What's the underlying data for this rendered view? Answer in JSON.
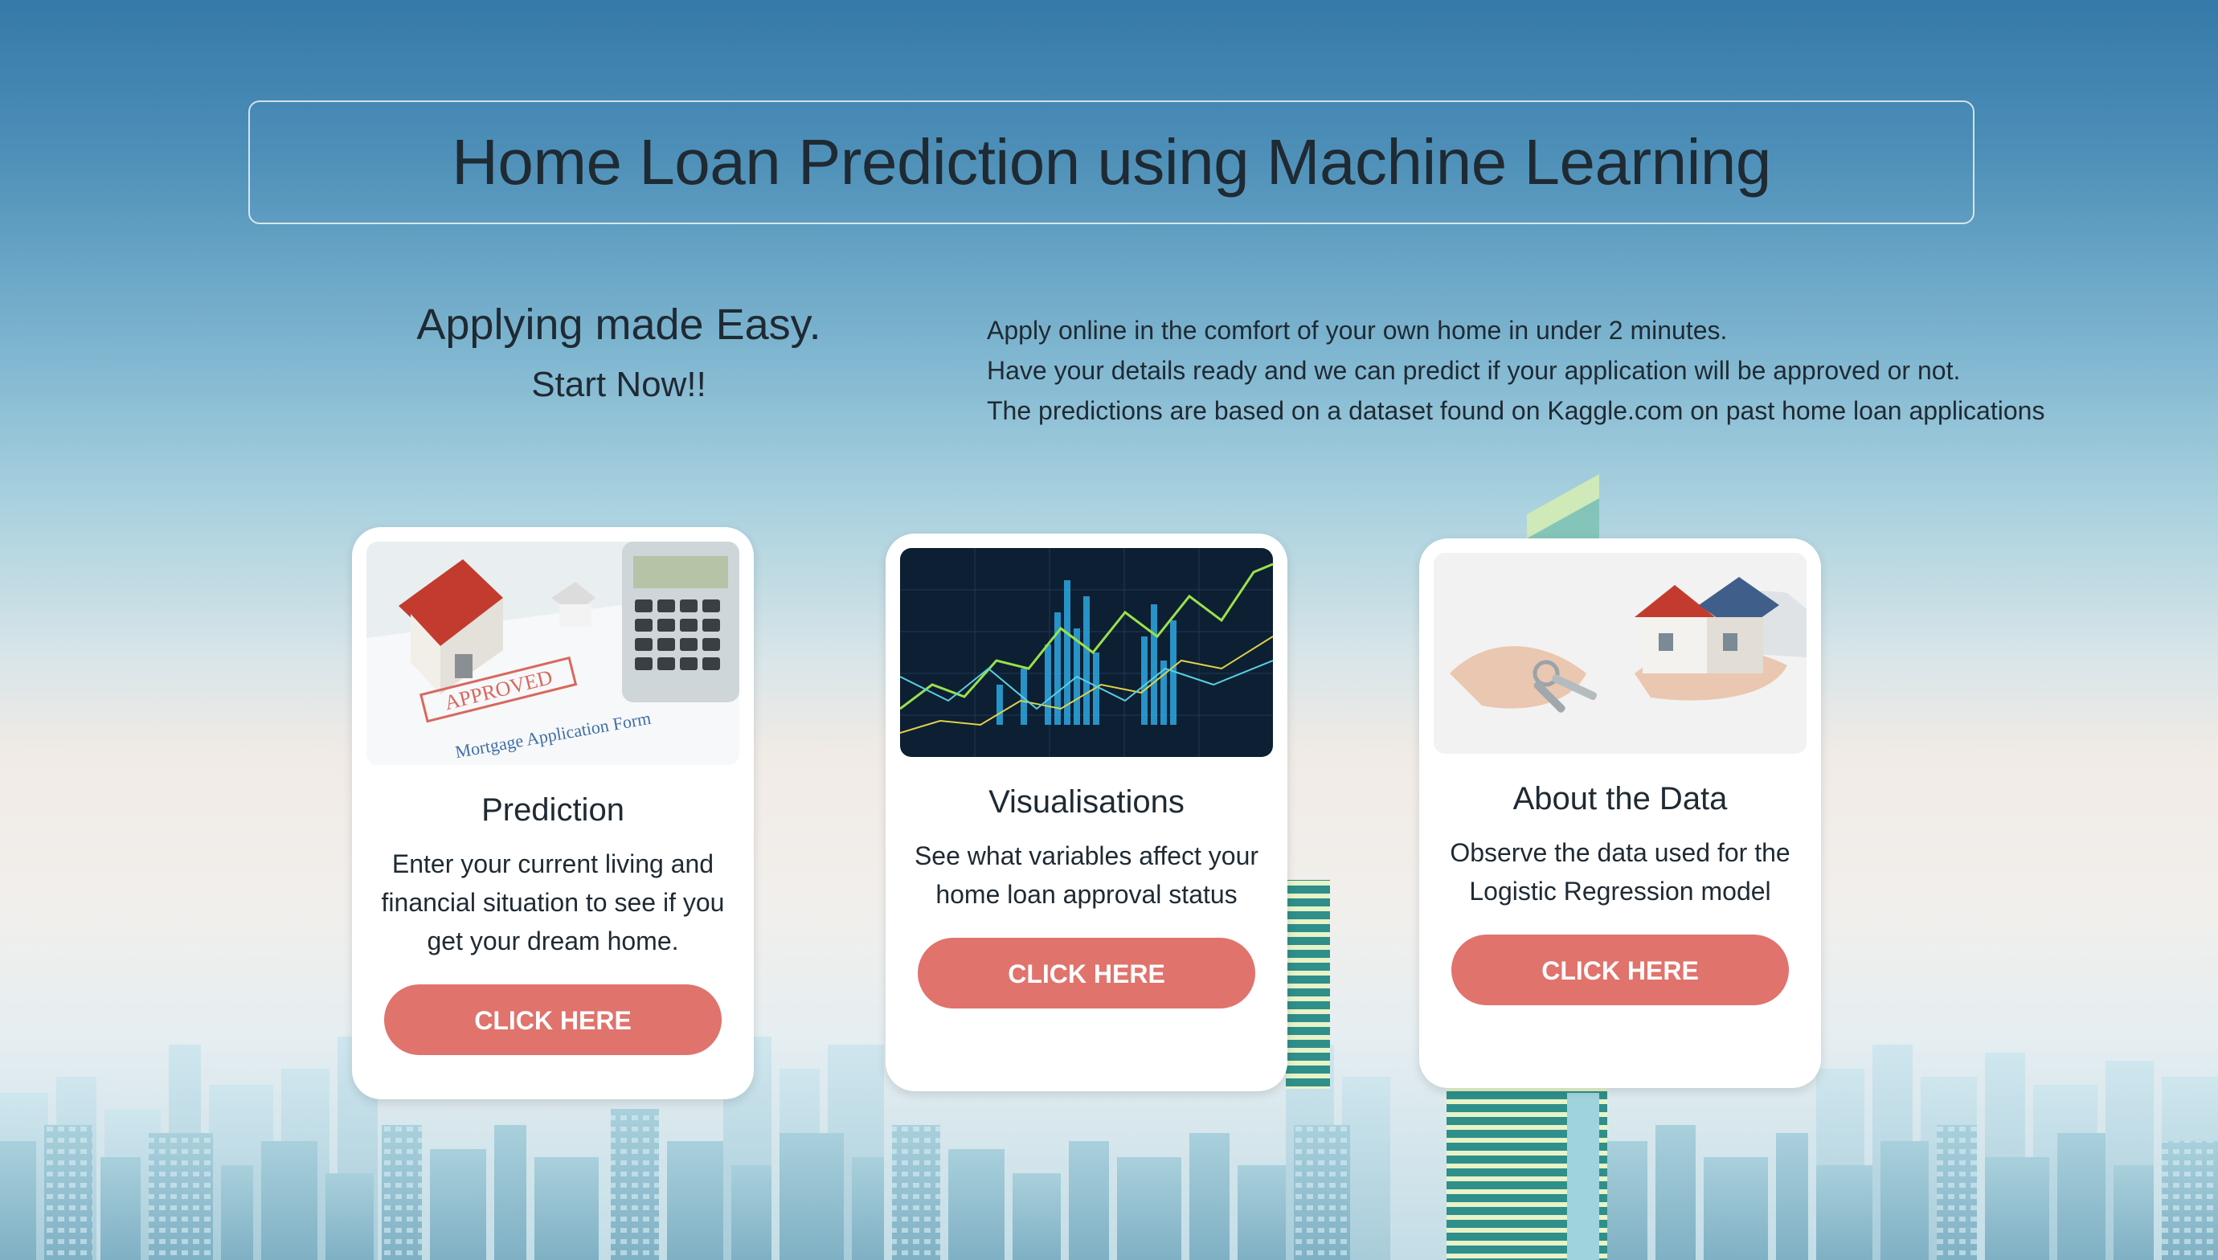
{
  "header": {
    "title": "Home Loan Prediction using Machine Learning"
  },
  "tagline": {
    "line1": "Applying made Easy.",
    "line2": "Start Now!!"
  },
  "intro": {
    "lines": [
      "Apply online in the comfort of your own home in under 2 minutes.",
      "Have your details ready and we can predict if your application will be approved or not.",
      "The predictions are based on a dataset found on Kaggle.com on past home loan applications"
    ]
  },
  "cards": [
    {
      "title": "Prediction",
      "description": "Enter your current living and financial situation to see if you get your dream home.",
      "button": "CLICK HERE",
      "image": {
        "stamp": "APPROVED",
        "form_text": "Mortgage Application Form"
      }
    },
    {
      "title": "Visualisations",
      "description": "See what variables affect your home loan approval status",
      "button": "CLICK HERE"
    },
    {
      "title": "About the Data",
      "description": "Observe the data used for the Logistic Regression model",
      "button": "CLICK HERE"
    }
  ],
  "colors": {
    "button": "#e0736c",
    "title_text": "#1f2a33",
    "sky_top": "#3579a8"
  }
}
